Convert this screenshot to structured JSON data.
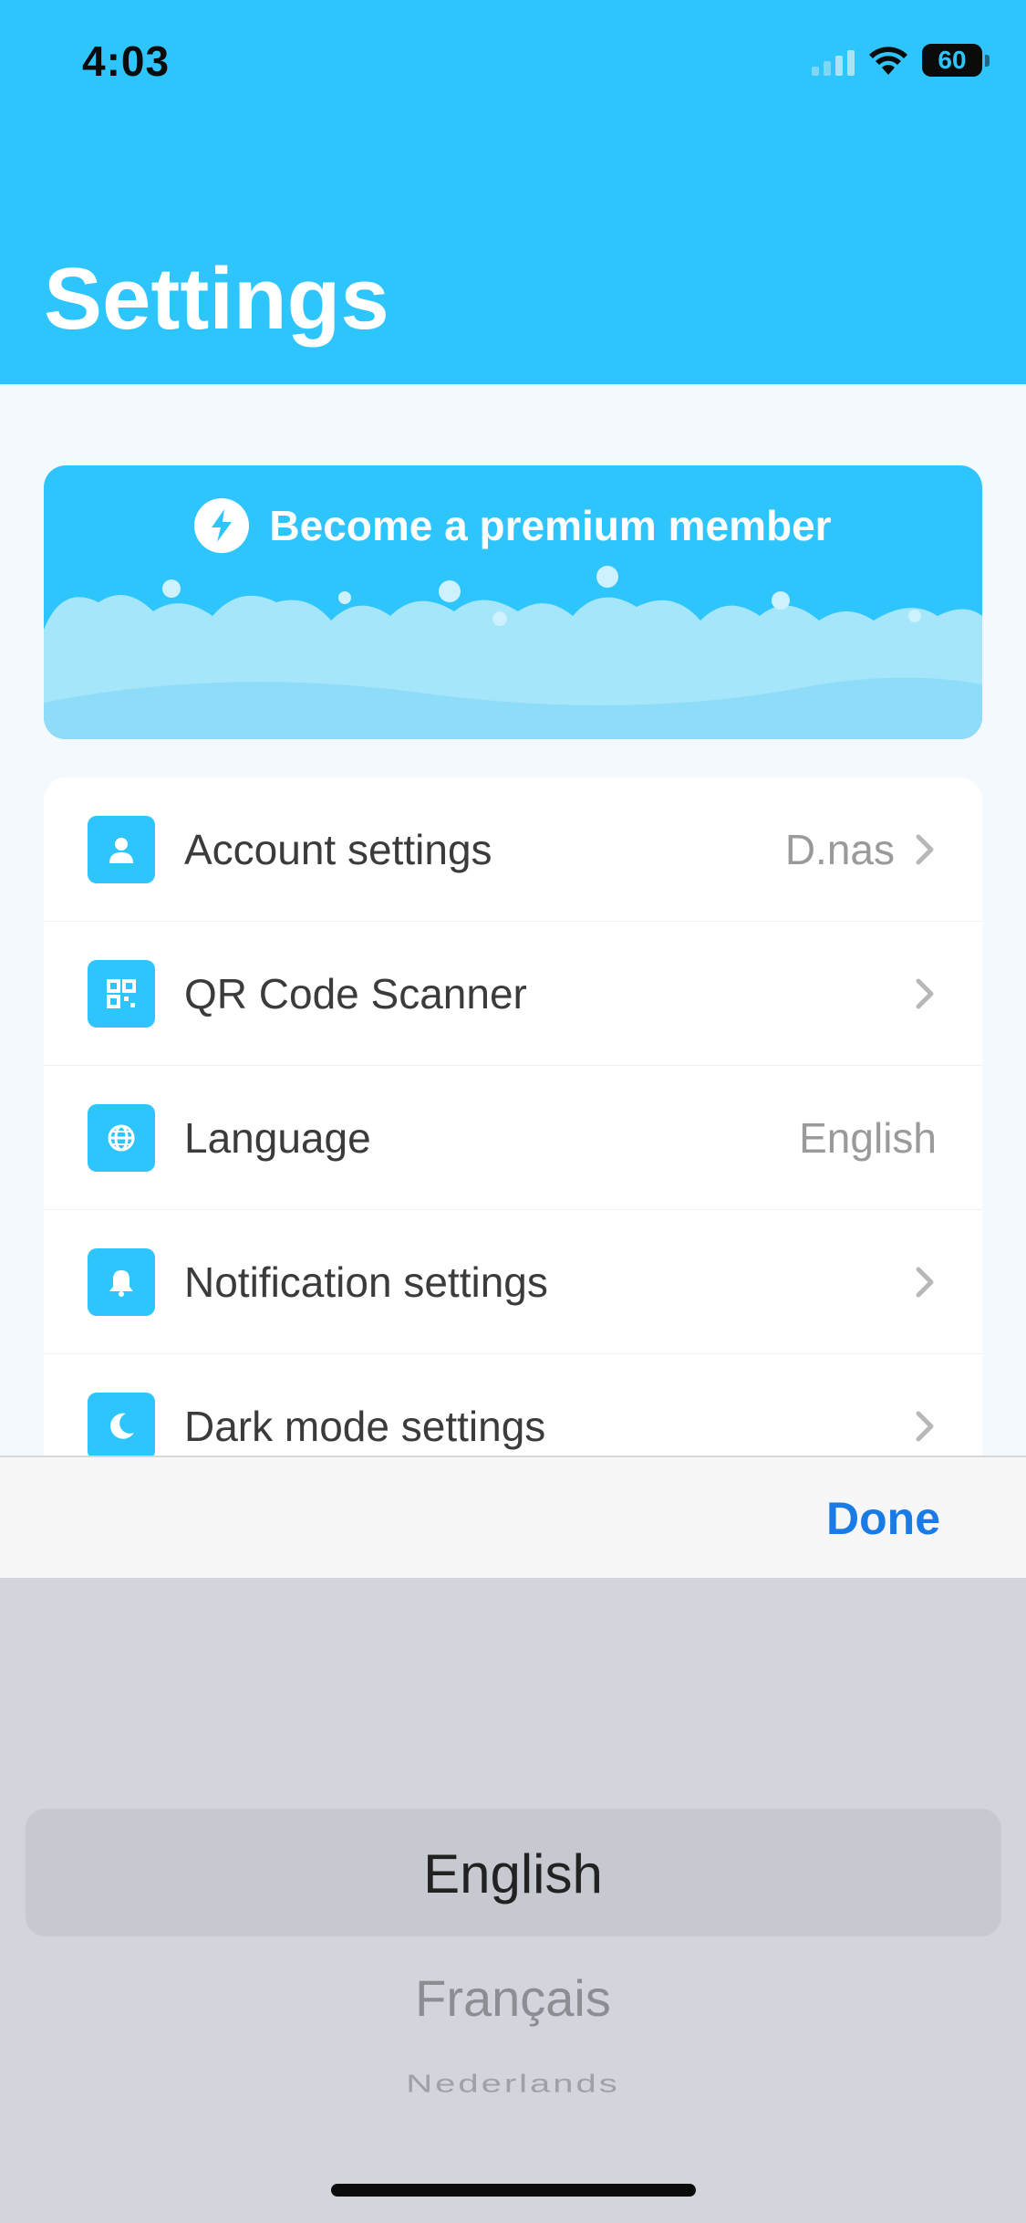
{
  "status_bar": {
    "time": "4:03",
    "battery": "60"
  },
  "header": {
    "title": "Settings"
  },
  "premium": {
    "label": "Become a premium member"
  },
  "settings": {
    "items": [
      {
        "label": "Account settings",
        "value": "D.nas",
        "icon": "person-icon",
        "chevron": true
      },
      {
        "label": "QR Code Scanner",
        "value": "",
        "icon": "qr-code-icon",
        "chevron": true
      },
      {
        "label": "Language",
        "value": "English",
        "icon": "globe-icon",
        "chevron": false
      },
      {
        "label": "Notification settings",
        "value": "",
        "icon": "bell-icon",
        "chevron": true
      },
      {
        "label": "Dark mode settings",
        "value": "",
        "icon": "moon-icon",
        "chevron": true
      }
    ]
  },
  "picker": {
    "done_label": "Done",
    "options": [
      "English",
      "Français",
      "Nederlands"
    ],
    "selected": "English"
  },
  "colors": {
    "accent": "#2ec5fc",
    "link": "#1a7be6"
  }
}
